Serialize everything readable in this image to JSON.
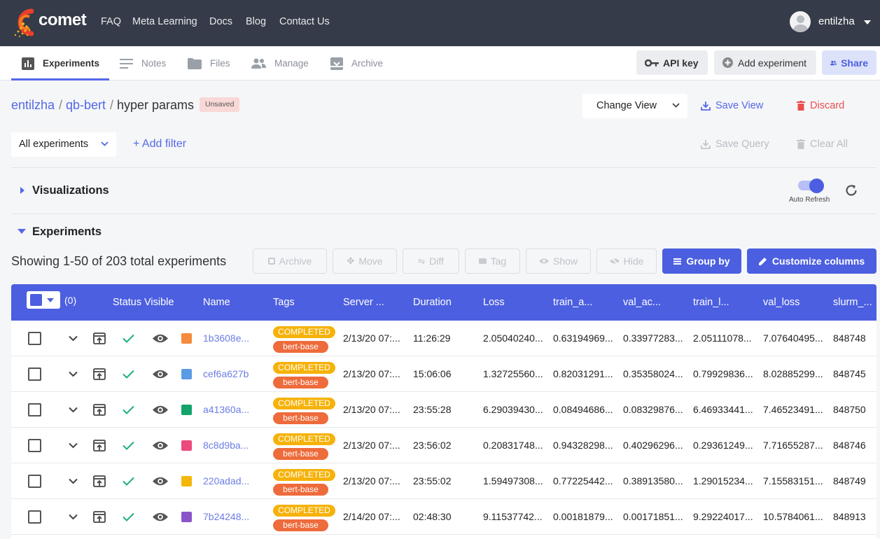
{
  "header": {
    "brand": "comet",
    "nav": [
      "FAQ",
      "Meta Learning",
      "Docs",
      "Blog",
      "Contact Us"
    ],
    "username": "entilzha"
  },
  "subnav": {
    "tabs": [
      "Experiments",
      "Notes",
      "Files",
      "Manage",
      "Archive"
    ],
    "api_key": "API key",
    "add_experiment": "Add experiment",
    "share": "Share"
  },
  "breadcrumb": {
    "workspace": "entilzha",
    "project": "qb-bert",
    "view": "hyper params",
    "sep": "/",
    "unsaved": "Unsaved"
  },
  "view_controls": {
    "change_view": "Change View",
    "save_view": "Save View",
    "discard": "Discard"
  },
  "filters": {
    "all_experiments": "All experiments",
    "add_filter": "+ Add filter",
    "save_query": "Save Query",
    "clear_all": "Clear All"
  },
  "visualizations": {
    "title": "Visualizations",
    "auto_refresh": "Auto Refresh",
    "auto_refresh_on": true
  },
  "experiments": {
    "title": "Experiments",
    "showing": "Showing 1-50 of 203 total experiments",
    "toolbar": {
      "archive": "Archive",
      "move": "Move",
      "diff": "Diff",
      "tag": "Tag",
      "show": "Show",
      "hide": "Hide",
      "group_by": "Group by",
      "customize_columns": "Customize columns"
    }
  },
  "table": {
    "selected_count": "(0)",
    "columns": [
      "Status",
      "Visible",
      "Name",
      "Tags",
      "Server ...",
      "Duration",
      "Loss",
      "train_a...",
      "val_ac...",
      "train_l...",
      "val_loss",
      "slurm_..."
    ],
    "rows": [
      {
        "color": "#f58b3c",
        "name": "1b3608e...",
        "status_tag": "COMPLETED",
        "tag": "bert-base",
        "server": "2/13/20 07:...",
        "duration": "11:26:29",
        "loss": "2.05040240...",
        "train_a": "0.63194969...",
        "val_ac": "0.33977283...",
        "train_l": "2.05111078...",
        "val_loss": "7.07640495...",
        "slurm": "848748"
      },
      {
        "color": "#5b9be3",
        "name": "cef6a627b",
        "status_tag": "COMPLETED",
        "tag": "bert-base",
        "server": "2/13/20 07:...",
        "duration": "15:06:06",
        "loss": "1.32725560...",
        "train_a": "0.82031291...",
        "val_ac": "0.35358024...",
        "train_l": "0.79929836...",
        "val_loss": "8.02885299...",
        "slurm": "848745"
      },
      {
        "color": "#14a36b",
        "name": "a41360a...",
        "status_tag": "COMPLETED",
        "tag": "bert-base",
        "server": "2/13/20 07:...",
        "duration": "23:55:28",
        "loss": "6.29039430...",
        "train_a": "0.08494686...",
        "val_ac": "0.08329876...",
        "train_l": "6.46933441...",
        "val_loss": "7.46523491...",
        "slurm": "848750"
      },
      {
        "color": "#ec4a7c",
        "name": "8c8d9ba...",
        "status_tag": "COMPLETED",
        "tag": "bert-base",
        "server": "2/13/20 07:...",
        "duration": "23:56:02",
        "loss": "0.20831748...",
        "train_a": "0.94328298...",
        "val_ac": "0.40296296...",
        "train_l": "0.29361249...",
        "val_loss": "7.71655287...",
        "slurm": "848746"
      },
      {
        "color": "#f3b70c",
        "name": "220adad...",
        "status_tag": "COMPLETED",
        "tag": "bert-base",
        "server": "2/13/20 07:...",
        "duration": "23:55:02",
        "loss": "1.59497308...",
        "train_a": "0.77225442...",
        "val_ac": "0.38913580...",
        "train_l": "1.29015234...",
        "val_loss": "7.15583151...",
        "slurm": "848749"
      },
      {
        "color": "#8a55c9",
        "name": "7b24248...",
        "status_tag": "COMPLETED",
        "tag": "bert-base",
        "server": "2/14/20 07:...",
        "duration": "02:48:30",
        "loss": "9.11537742...",
        "train_a": "0.00181879...",
        "val_ac": "0.00171851...",
        "train_l": "9.29224017...",
        "val_loss": "10.5784061...",
        "slurm": "848913"
      }
    ]
  }
}
